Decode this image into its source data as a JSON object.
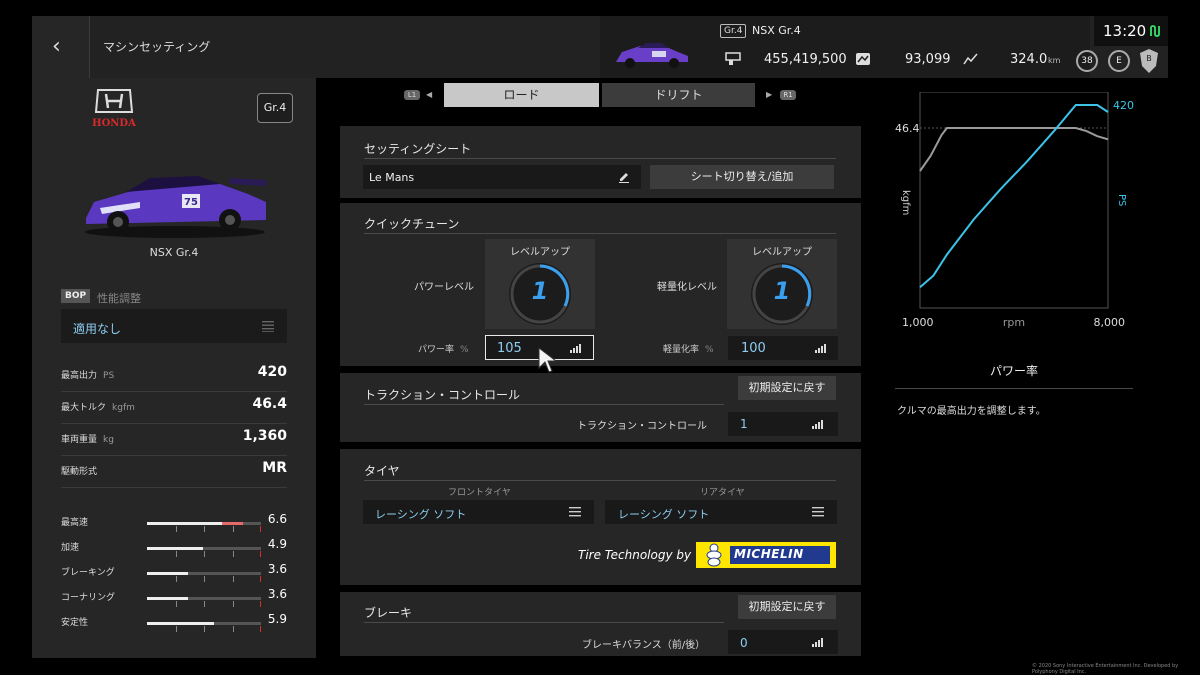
{
  "header": {
    "title": "マシンセッティング",
    "car_class": "Gr.4",
    "car_name": "NSX Gr.4",
    "credits": "455,419,500",
    "odometer": "93,099",
    "top_speed": "324.0",
    "speed_unit": "km",
    "level": "38",
    "e_badge": "E",
    "clock": "13:20"
  },
  "car": {
    "brand": "HONDA",
    "class_badge": "Gr.4",
    "name": "NSX Gr.4",
    "bop_badge": "BOP",
    "bop_label": "性能調整",
    "bop_value": "適用なし",
    "specs": [
      {
        "label": "最高出力",
        "unit": "PS",
        "value": "420"
      },
      {
        "label": "最大トルク",
        "unit": "kgfm",
        "value": "46.4"
      },
      {
        "label": "車両重量",
        "unit": "kg",
        "value": "1,360"
      },
      {
        "label": "駆動形式",
        "unit": "",
        "value": "MR"
      }
    ],
    "ratings": [
      {
        "label": "最高速",
        "value": "6.6",
        "fill": 0.66,
        "highlight": 0.18
      },
      {
        "label": "加速",
        "value": "4.9",
        "fill": 0.49,
        "highlight": 0.0
      },
      {
        "label": "ブレーキング",
        "value": "3.6",
        "fill": 0.36,
        "highlight": 0.0
      },
      {
        "label": "コーナリング",
        "value": "3.6",
        "fill": 0.36,
        "highlight": 0.0
      },
      {
        "label": "安定性",
        "value": "5.9",
        "fill": 0.59,
        "highlight": 0.0
      }
    ]
  },
  "tabs": {
    "l1": "L1",
    "r1": "R1",
    "road": "ロード",
    "drift": "ドリフト"
  },
  "setting_sheet": {
    "title": "セッティングシート",
    "sheet_name": "Le Mans",
    "switch_button": "シート切り替え/追加"
  },
  "quick_tune": {
    "title": "クイックチューン",
    "power_level_label": "パワーレベル",
    "power_level_caption": "レベルアップ",
    "power_level": "1",
    "weight_level_label": "軽量化レベル",
    "weight_level_caption": "レベルアップ",
    "weight_level": "1",
    "power_ratio_label": "パワー率",
    "power_ratio_unit": "%",
    "power_ratio": "105",
    "weight_ratio_label": "軽量化率",
    "weight_ratio_unit": "%",
    "weight_ratio": "100"
  },
  "traction": {
    "title": "トラクション・コントロール",
    "reset_button": "初期設定に戻す",
    "field_label": "トラクション・コントロール",
    "value": "1"
  },
  "tires": {
    "title": "タイヤ",
    "front_label": "フロントタイヤ",
    "rear_label": "リアタイヤ",
    "front_value": "レーシング ソフト",
    "rear_value": "レーシング ソフト",
    "tech_text": "Tire Technology by",
    "michelin": "MICHELIN"
  },
  "brakes": {
    "title": "ブレーキ",
    "reset_button": "初期設定に戻す",
    "balance_label": "ブレーキバランス（前/後）",
    "balance_value": "0"
  },
  "graph": {
    "title": "パワー率",
    "description": "クルマの最高出力を調整します。",
    "torque_label": "kgfm",
    "power_label": "PS",
    "torque_max_label": "46.4",
    "power_max_label": "420",
    "x_min": "1,000",
    "x_unit": "rpm",
    "x_max": "8,000"
  },
  "chart_data": {
    "type": "line",
    "title": "",
    "xlabel": "rpm",
    "xlim": [
      1000,
      8000
    ],
    "series": [
      {
        "name": "kgfm",
        "x": [
          1000,
          1400,
          1800,
          2000,
          2500,
          3000,
          4000,
          5000,
          6000,
          6800,
          7200,
          7600,
          8000
        ],
        "y": [
          38,
          41,
          45,
          46.4,
          46.4,
          46.4,
          46.4,
          46.4,
          46.4,
          46.4,
          45.8,
          44.8,
          44.2
        ]
      },
      {
        "name": "PS",
        "x": [
          1000,
          1500,
          2000,
          3000,
          4000,
          5000,
          6000,
          6800,
          7200,
          7600,
          8000
        ],
        "y": [
          30,
          55,
          100,
          175,
          240,
          300,
          365,
          420,
          420,
          420,
          405
        ]
      }
    ]
  },
  "colors": {
    "accent_blue": "#3aa0ee",
    "power_line": "#3cc3e8",
    "torque_line": "#9a9a9a",
    "value_blue": "#8ecdf0"
  },
  "footer": {
    "copyright": "© 2020 Sony Interactive Entertainment Inc. Developed by Polyphony Digital Inc."
  }
}
